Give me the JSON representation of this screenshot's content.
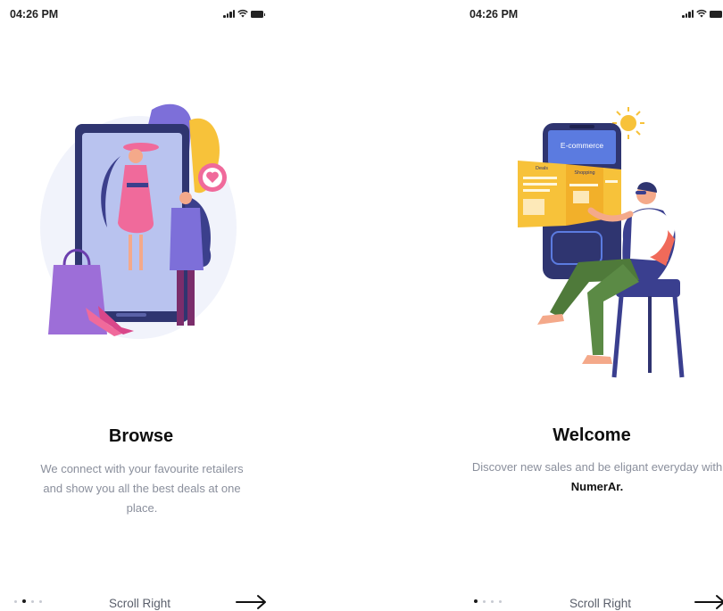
{
  "screens": [
    {
      "time": "04:26 PM",
      "title": "Browse",
      "description": "We connect with your favourite retailers and show you all the best deals at one place.",
      "pager": {
        "count": 4,
        "active": 2
      },
      "scroll_label": "Scroll Right",
      "illustration": "woman-shopping-mirror-illustration"
    },
    {
      "time": "04:26 PM",
      "title": "Welcome",
      "description_part1": "Discover new sales and be eligant everyday with ",
      "description_brand": "NumerAr.",
      "pager": {
        "count": 4,
        "active": 1
      },
      "scroll_label": "Scroll Right",
      "illustration": "man-chair-ecommerce-illustration",
      "phone_label": "E-commerce",
      "panel_labels": [
        "Deals",
        "Shopping"
      ]
    }
  ],
  "colors": {
    "accent_purple": "#6b5bd6",
    "pink": "#f06a9b",
    "yellow": "#f7c23a",
    "navy": "#3a3f8f",
    "text_muted": "#8a8f9c"
  }
}
